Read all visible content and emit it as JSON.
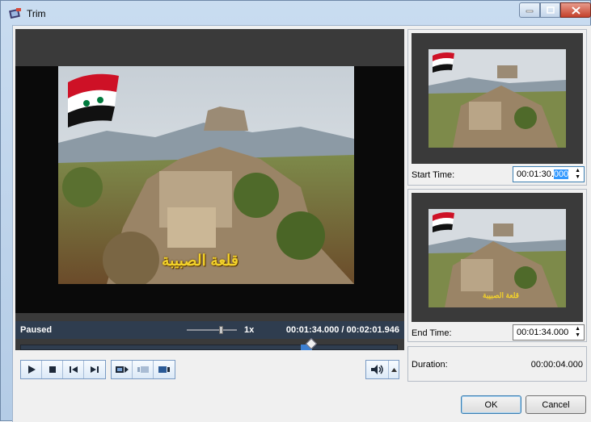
{
  "window": {
    "title": "Trim"
  },
  "player": {
    "status": "Paused",
    "speed": "1x",
    "current_time": "00:01:34.000",
    "separator": "/",
    "total_time": "00:02:01.946",
    "overlay_caption": "قلعة الصبيبة",
    "playhead_fraction": 0.771,
    "speed_slider_fraction": 0.65
  },
  "controls": {
    "play": "play-icon",
    "stop": "stop-icon",
    "prev_frame": "previous-frame-icon",
    "next_frame": "next-frame-icon",
    "set_in": "mark-in-icon",
    "set_start": "set-start-icon",
    "set_end": "set-end-icon",
    "volume": "volume-icon"
  },
  "start_panel": {
    "label": "Start Time:",
    "value_prefix": "00:01:30.",
    "value_selected": "000"
  },
  "end_panel": {
    "label": "End Time:",
    "value": "00:01:34.000",
    "overlay_caption": "قلعة الصبيبة"
  },
  "duration": {
    "label": "Duration:",
    "value": "00:00:04.000"
  },
  "buttons": {
    "ok": "OK",
    "cancel": "Cancel"
  },
  "colors": {
    "accent": "#3c7fd1",
    "status_bar": "#2f3d4f",
    "flag_red": "#ce1126",
    "flag_green": "#007a3d"
  }
}
